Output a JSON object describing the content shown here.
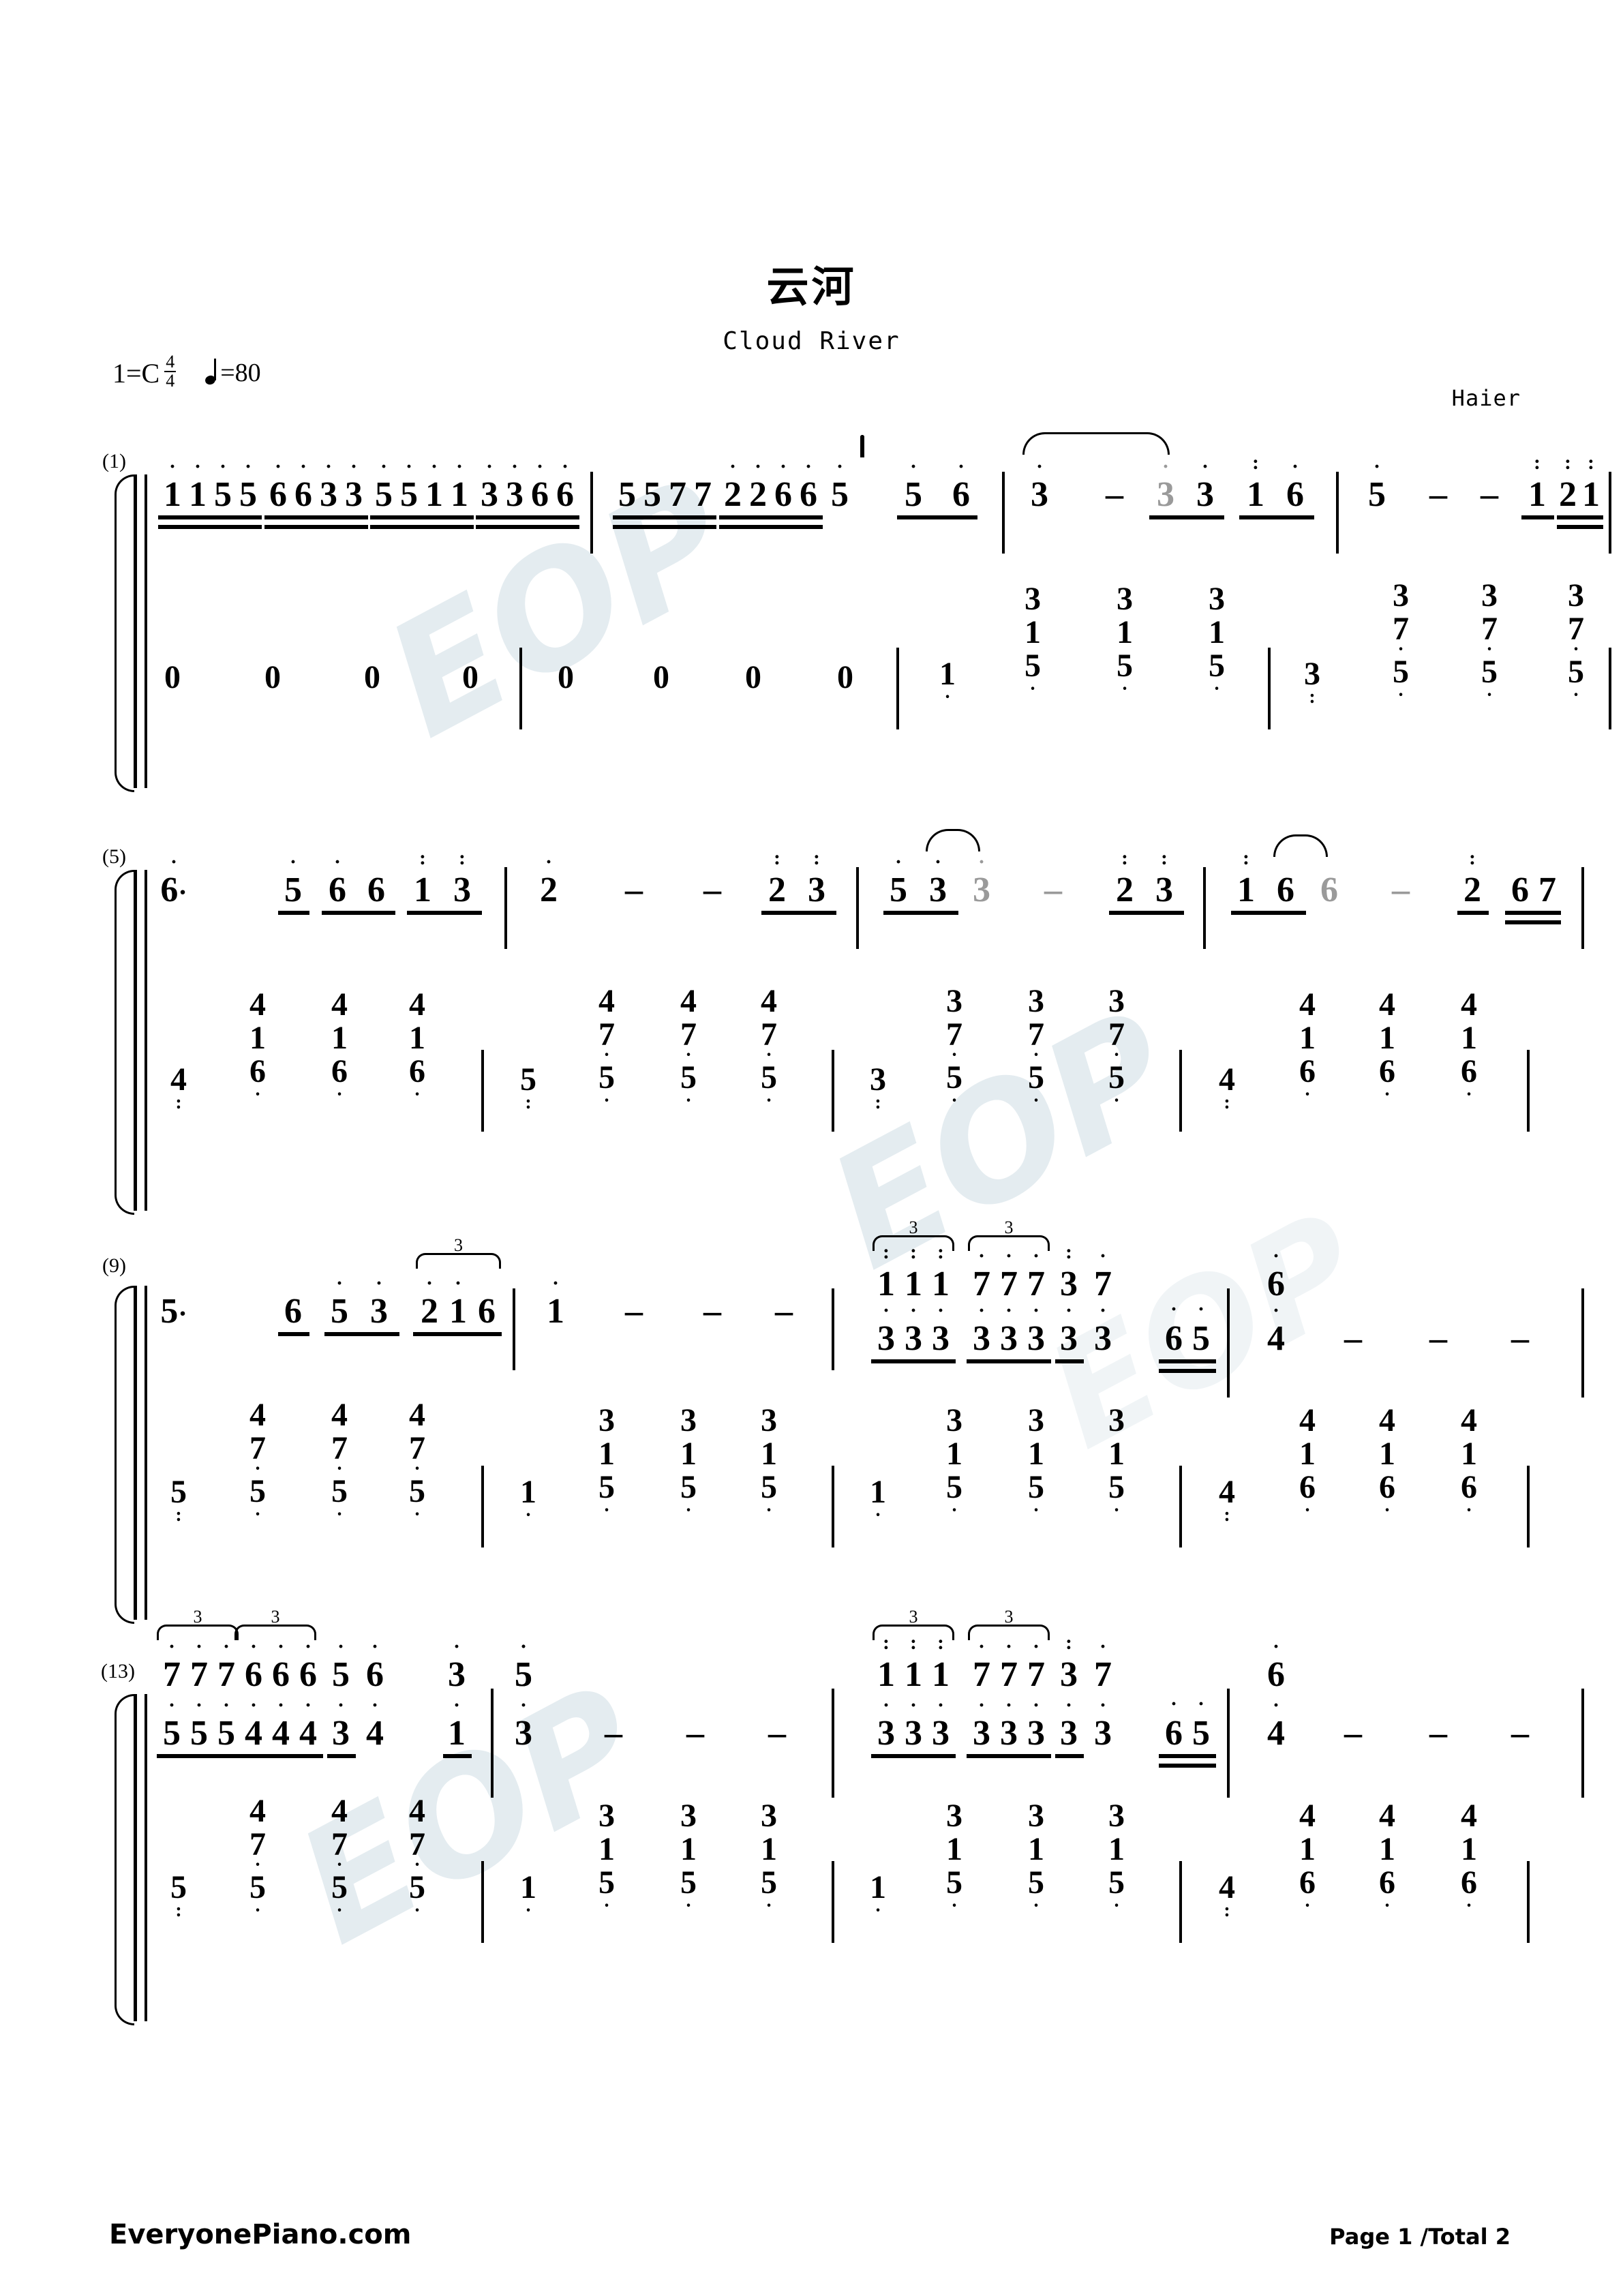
{
  "document": {
    "title_cn": "云河",
    "title_en": "Cloud River",
    "composer": "Haier",
    "key_label": "1=C",
    "time_num": "4",
    "time_den": "4",
    "tempo_label": "=80",
    "site": "EveryonePiano.com",
    "page_label": "Page 1 /Total 2",
    "watermark": "EOP"
  },
  "systems": [
    {
      "measure_number": "(1)",
      "melody": {
        "measures": [
          {
            "tokens": "1155 6633 5511 3366",
            "beamed": true,
            "octave": "high"
          },
          {
            "tokens": "5577 2266 5   5 6",
            "beamed": true
          },
          {
            "tokens": "3 - 3 3 1 6",
            "slur": true
          },
          {
            "tokens": "5 - - 1 21"
          }
        ]
      },
      "bass": {
        "measures": [
          {
            "tokens": "0 0 0 0"
          },
          {
            "tokens": "0 0 0 0"
          },
          {
            "tokens": "1. [3/1/5] [3/1/5] [3/1/5]"
          },
          {
            "tokens": "3: [3/7/5] [3/7/5] [3/7/5]"
          }
        ]
      }
    },
    {
      "measure_number": "(5)",
      "melody": {
        "measures": [
          {
            "tokens": "6. 5 6 6 1 3"
          },
          {
            "tokens": "2 - - 2 3"
          },
          {
            "tokens": "5 3 3 - 2 3"
          },
          {
            "tokens": "1 6 6 - 2 67"
          }
        ]
      },
      "bass": {
        "measures": [
          {
            "tokens": "4: [4/1/6] [4/1/6] [4/1/6]"
          },
          {
            "tokens": "5: [4/7/5] [4/7/5] [4/7/5]"
          },
          {
            "tokens": "3: [3/7/5] [3/7/5] [3/7/5]"
          },
          {
            "tokens": "4: [4/1/6] [4/1/6] [4/1/6]"
          }
        ]
      }
    },
    {
      "measure_number": "(9)",
      "melody": {
        "measures": [
          {
            "tokens": "5. 6 5 3 [216]3"
          },
          {
            "tokens": "1 - - - -"
          },
          {
            "tokens": "[111]3 [777]3 3 7 / 333 333 3 3 65"
          },
          {
            "tokens": "6 / 4 - - -"
          }
        ]
      },
      "bass": {
        "measures": [
          {
            "tokens": "5: [4/7/5] [4/7/5] [4/7/5]"
          },
          {
            "tokens": "1. [3/1/5] [3/1/5] [3/1/5]"
          },
          {
            "tokens": "1. [3/1/5] [3/1/5] [3/1/5]"
          },
          {
            "tokens": "4: [4/1/6] [4/1/6] [4/1/6]"
          }
        ]
      }
    },
    {
      "measure_number": "(13)",
      "melody": {
        "measures": [
          {
            "tokens": "[777]3 [666]3 5 6 3 5 / 555 444 3 4 1 3"
          },
          {
            "tokens": "3 - - -"
          },
          {
            "tokens": "[111]3 [777]3 3 7 / 333 333 3 3 65"
          },
          {
            "tokens": "6 / 4 - - -"
          }
        ]
      },
      "bass": {
        "measures": [
          {
            "tokens": "5: [4/7/5] [4/7/5] [4/7/5]"
          },
          {
            "tokens": "1. [3/1/5] [3/1/5] [3/1/5]"
          },
          {
            "tokens": "1. [3/1/5] [3/1/5] [3/1/5]"
          },
          {
            "tokens": "4: [4/1/6] [4/1/6] [4/1/6]"
          }
        ]
      }
    }
  ],
  "notes": {
    "s1": {
      "m1": [
        "1",
        "1",
        "5",
        "5",
        "6",
        "6",
        "3",
        "3",
        "5",
        "5",
        "1",
        "1",
        "3",
        "3",
        "6",
        "6"
      ],
      "m2": [
        "5",
        "5",
        "7",
        "7",
        "2",
        "2",
        "6",
        "6",
        "5",
        "5",
        "6"
      ],
      "m3": [
        "3",
        "-",
        "3",
        "3",
        "1",
        "6"
      ],
      "m4": [
        "5",
        "-",
        "-",
        "1",
        "2",
        "1"
      ],
      "b3": [
        "1",
        "3",
        "1",
        "5",
        "3",
        "1",
        "5",
        "3",
        "1",
        "5"
      ],
      "b4": [
        "3",
        "3",
        "7",
        "5",
        "3",
        "7",
        "5",
        "3",
        "7",
        "5"
      ],
      "rest": "0"
    },
    "s2": {
      "m5": [
        "6",
        "5",
        "6",
        "6",
        "1",
        "3"
      ],
      "m6": [
        "2",
        "-",
        "-",
        "2",
        "3"
      ],
      "m7": [
        "5",
        "3",
        "3",
        "-",
        "2",
        "3"
      ],
      "m8": [
        "1",
        "6",
        "6",
        "-",
        "2",
        "6",
        "7"
      ]
    },
    "s3": {
      "m9": [
        "5",
        "6",
        "5",
        "3",
        "2",
        "1",
        "6"
      ],
      "m10": [
        "1",
        "-",
        "-",
        "-"
      ],
      "m11u": [
        "1",
        "1",
        "1",
        "7",
        "7",
        "7",
        "3",
        "7",
        "6"
      ],
      "m11l": [
        "3",
        "3",
        "3",
        "3",
        "3",
        "3",
        "3",
        "3",
        "6",
        "5"
      ],
      "m12": [
        "4",
        "-",
        "-",
        "-"
      ]
    },
    "s4": {
      "m13u": [
        "7",
        "7",
        "7",
        "6",
        "6",
        "6",
        "5",
        "6",
        "3",
        "5"
      ],
      "m13l": [
        "5",
        "5",
        "5",
        "4",
        "4",
        "4",
        "3",
        "4",
        "1",
        "3"
      ],
      "m14": [
        "3",
        "-",
        "-",
        "-"
      ],
      "triplet_label": "3"
    }
  }
}
